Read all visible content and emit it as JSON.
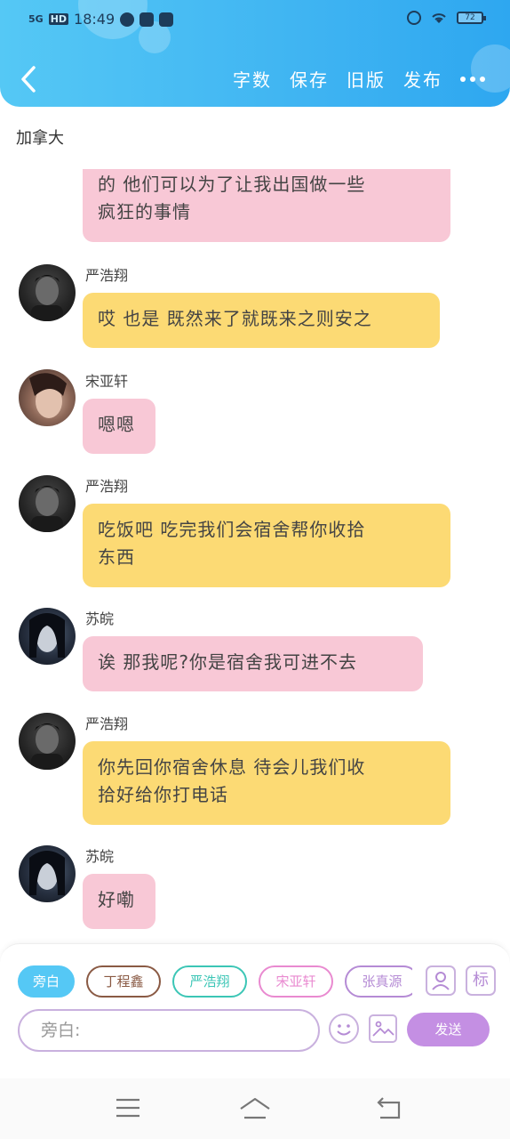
{
  "status_bar": {
    "signal": "5G",
    "hd": "HD",
    "time": "18:49",
    "battery": "72"
  },
  "header": {
    "actions": [
      "字数",
      "保存",
      "旧版",
      "发布"
    ]
  },
  "chat_title": "加拿大",
  "messages": [
    {
      "sender": "",
      "avatar": "none",
      "color": "pink",
      "lines": [
        "的 他们可以为了让我出国做一些",
        "疯狂的事情"
      ]
    },
    {
      "sender": "严浩翔",
      "avatar": "dark",
      "color": "yellow",
      "lines": [
        "哎 也是 既然来了就既来之则安之"
      ]
    },
    {
      "sender": "宋亚轩",
      "avatar": "warm",
      "color": "pink",
      "lines": [
        "嗯嗯"
      ]
    },
    {
      "sender": "严浩翔",
      "avatar": "dark",
      "color": "yellow",
      "lines": [
        "吃饭吧 吃完我们会宿舍帮你收拾",
        "东西"
      ]
    },
    {
      "sender": "苏皖",
      "avatar": "night",
      "color": "pink",
      "lines": [
        "诶 那我呢?你是宿舍我可进不去"
      ]
    },
    {
      "sender": "严浩翔",
      "avatar": "dark",
      "color": "yellow",
      "lines": [
        "你先回你宿舍休息 待会儿我们收",
        "拾好给你打电话"
      ]
    },
    {
      "sender": "苏皖",
      "avatar": "night",
      "color": "pink",
      "lines": [
        "好嘞"
      ]
    }
  ],
  "composer": {
    "roles": [
      {
        "label": "旁白",
        "selected": true,
        "color": "#55c8f5"
      },
      {
        "label": "丁程鑫",
        "selected": false,
        "color": "#8a5a44"
      },
      {
        "label": "严浩翔",
        "selected": false,
        "color": "#3cc6b6"
      },
      {
        "label": "宋亚轩",
        "selected": false,
        "color": "#e98ad0"
      },
      {
        "label": "张真源",
        "selected": false,
        "color": "#b58bd5"
      }
    ],
    "tag_label": "标",
    "input_placeholder": "旁白:",
    "send_label": "发送"
  }
}
